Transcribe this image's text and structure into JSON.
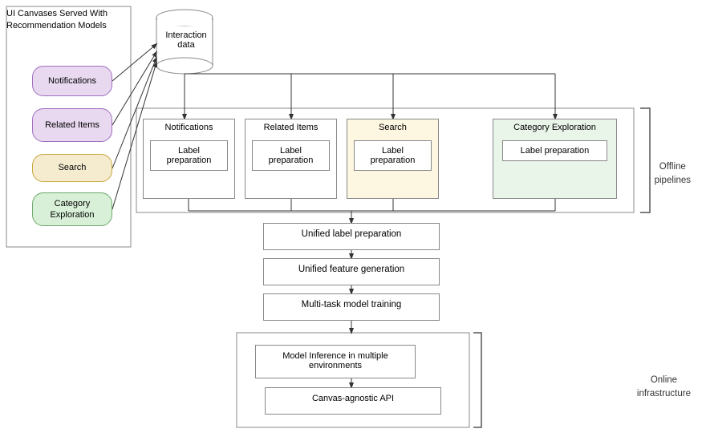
{
  "title": "UI Canvases Served With Recommendation Models",
  "interaction_data_label": "Interaction data",
  "canvas_boxes": [
    {
      "id": "notifications",
      "label": "Notifications",
      "bg": "#e8d8f0",
      "border": "#a070c0"
    },
    {
      "id": "related-items",
      "label": "Related Items",
      "bg": "#e8d8f0",
      "border": "#a070c0"
    },
    {
      "id": "search",
      "label": "Search",
      "bg": "#f5ecd0",
      "border": "#c8a840"
    },
    {
      "id": "category-exploration",
      "label": "Category Exploration",
      "bg": "#d8f0d8",
      "border": "#70a870"
    }
  ],
  "pipeline_boxes": [
    {
      "id": "notifications-pipeline",
      "title": "Notifications",
      "label_prep": "Label preparation"
    },
    {
      "id": "related-items-pipeline",
      "title": "Related Items",
      "label_prep": "Label preparation"
    },
    {
      "id": "search-pipeline",
      "title": "Search",
      "label_prep": "Label preparation"
    },
    {
      "id": "category-pipeline",
      "title": "Category Exploration",
      "label_prep": "Label preparation"
    }
  ],
  "unified_boxes": [
    {
      "id": "unified-label-prep",
      "label": "Unified label preparation"
    },
    {
      "id": "unified-feature-gen",
      "label": "Unified feature generation"
    },
    {
      "id": "multitask-training",
      "label": "Multi-task model training"
    }
  ],
  "online_boxes": [
    {
      "id": "model-inference",
      "label": "Model Inference in multiple environments"
    },
    {
      "id": "canvas-api",
      "label": "Canvas-agnostic API"
    }
  ],
  "section_labels": [
    {
      "id": "offline-label",
      "text": "Offline\npipelines"
    },
    {
      "id": "online-label",
      "text": "Online\ninfrastructure"
    }
  ]
}
